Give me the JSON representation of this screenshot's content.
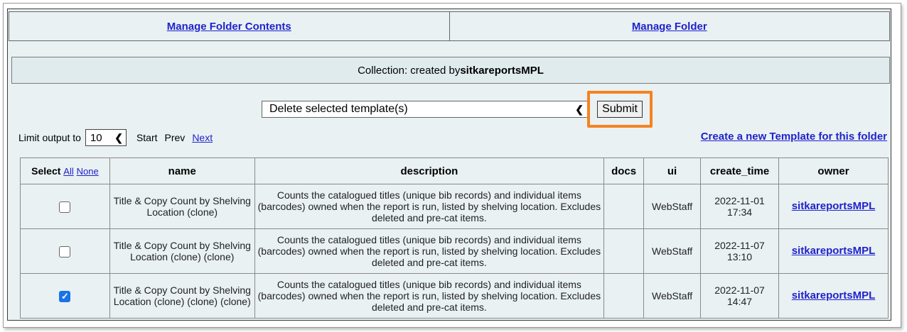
{
  "nav": {
    "manage_contents": "Manage Folder Contents",
    "manage_folder": "Manage Folder"
  },
  "collection": {
    "prefix": "Collection: created by ",
    "creator": "sitkareportsMPL"
  },
  "actions": {
    "selected": "Delete selected template(s)",
    "submit": "Submit",
    "highlight_color": "#f58220"
  },
  "paging": {
    "limit_label": "Limit output to",
    "limit_value": "10",
    "start": "Start",
    "prev": "Prev",
    "next": "Next"
  },
  "create_link": "Create a new Template for this folder",
  "table": {
    "headers": {
      "select": "Select",
      "all": "All",
      "none": "None",
      "name": "name",
      "description": "description",
      "docs": "docs",
      "ui": "ui",
      "create_time": "create_time",
      "owner": "owner"
    },
    "rows": [
      {
        "checked": false,
        "name": "Title & Copy Count by Shelving Location (clone)",
        "description": "Counts the catalogued titles (unique bib records) and individual items (barcodes) owned when the report is run, listed by shelving location. Excludes deleted and pre-cat items.",
        "docs": "",
        "ui": "WebStaff",
        "create_time": "2022-11-01 17:34",
        "owner": "sitkareportsMPL"
      },
      {
        "checked": false,
        "name": "Title & Copy Count by Shelving Location (clone) (clone)",
        "description": "Counts the catalogued titles (unique bib records) and individual items (barcodes) owned when the report is run, listed by shelving location. Excludes deleted and pre-cat items.",
        "docs": "",
        "ui": "WebStaff",
        "create_time": "2022-11-07 13:10",
        "owner": "sitkareportsMPL"
      },
      {
        "checked": true,
        "name": "Title & Copy Count by Shelving Location (clone) (clone) (clone)",
        "description": "Counts the catalogued titles (unique bib records) and individual items (barcodes) owned when the report is run, listed by shelving location. Excludes deleted and pre-cat items.",
        "docs": "",
        "ui": "WebStaff",
        "create_time": "2022-11-07 14:47",
        "owner": "sitkareportsMPL"
      }
    ]
  }
}
